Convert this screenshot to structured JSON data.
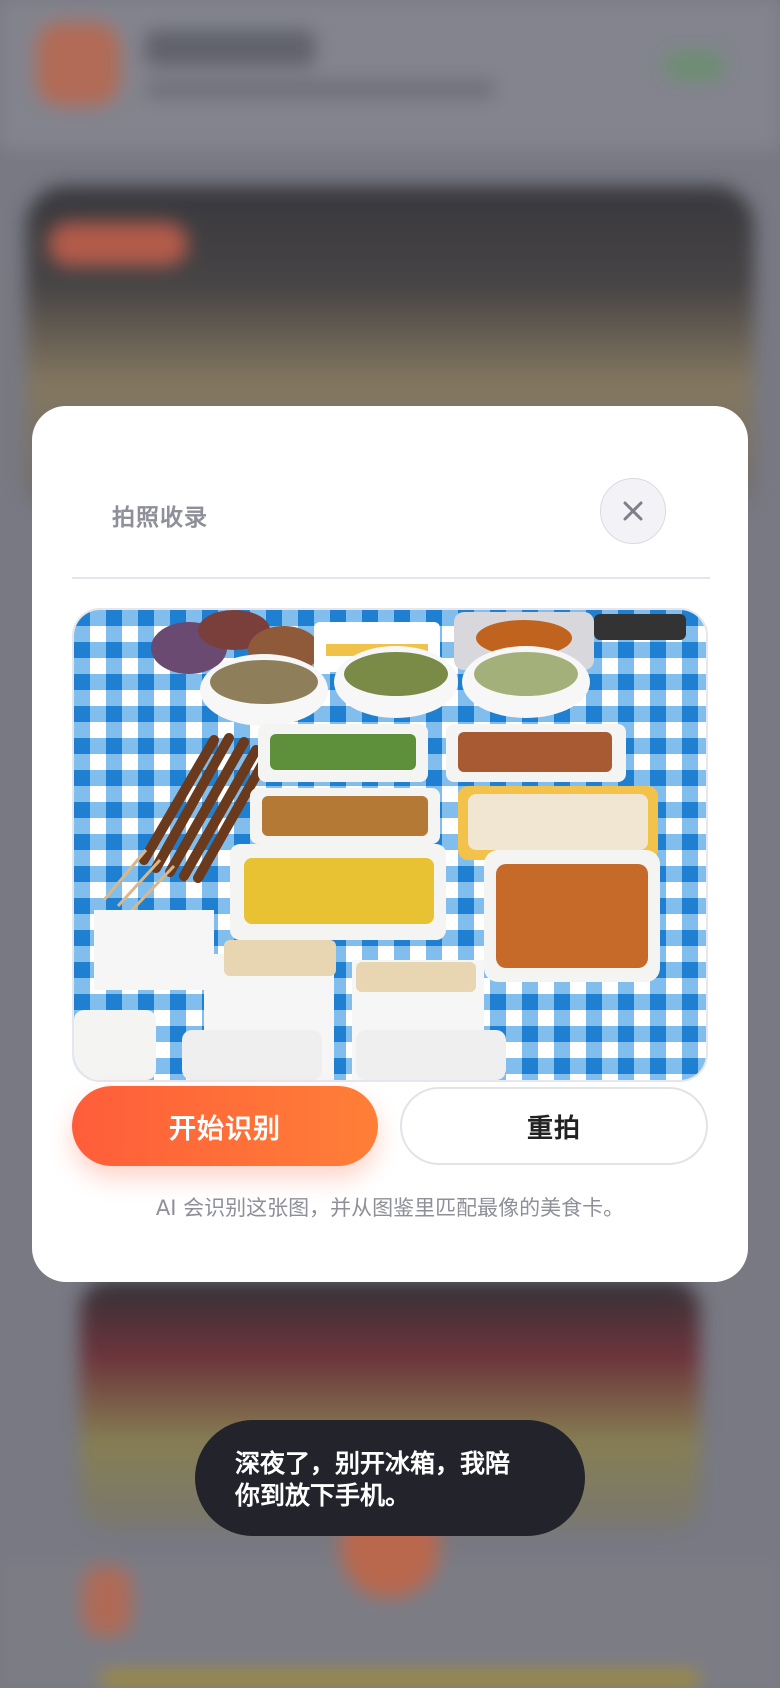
{
  "modal": {
    "title": "拍照收录",
    "close_icon": "close-icon",
    "photo_description_icon": "captured-food-photo",
    "primary_button": "开始识别",
    "secondary_button": "重拍",
    "hint": "AI 会识别这张图，并从图鉴里匹配最像的美食卡。"
  },
  "toast": {
    "line1": "深夜了，别开冰箱，我陪",
    "line2": "你到放下手机。"
  },
  "colors": {
    "accent_start": "#ff5d3a",
    "accent_end": "#ff7f37",
    "toast_bg": "#22232b",
    "muted_text": "#8e8f99"
  }
}
